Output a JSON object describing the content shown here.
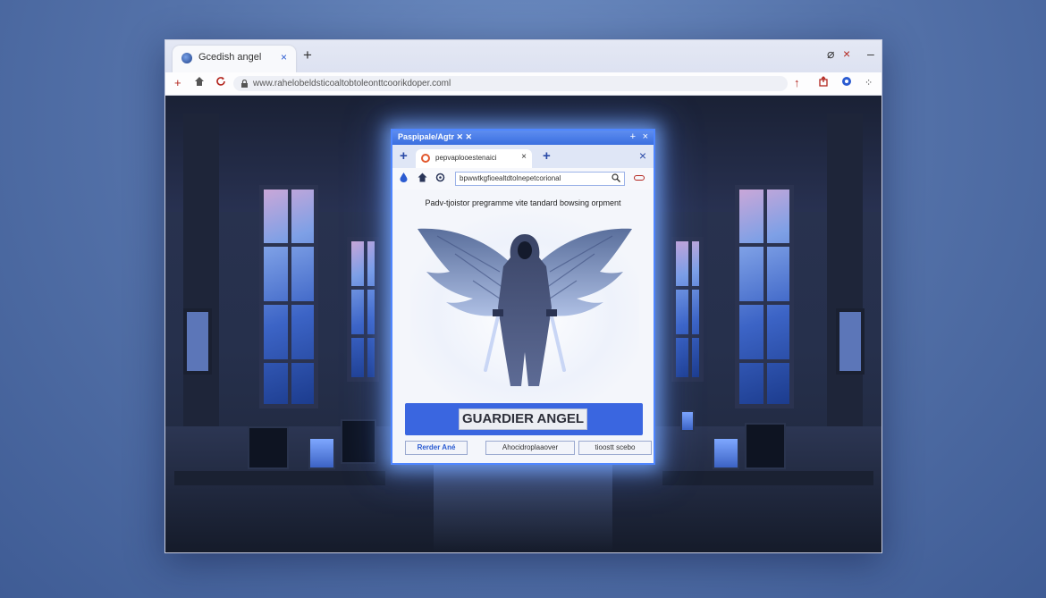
{
  "browser": {
    "tab_title": "Gcedish angel",
    "tab_close_glyph": "×",
    "new_tab_glyph": "+",
    "address_url": "www.rahelobeldsticoaltobtoleonttcoorikdoper.coml",
    "window_controls": {
      "pin": "⌀",
      "close": "×",
      "minimize": "–"
    }
  },
  "inner_window": {
    "title": "Paspipale/Agtr  ✕  ✕",
    "title_controls": {
      "plus": "+",
      "close": "×"
    },
    "tab_title": "pepvaplooestenaici",
    "tab_close_glyph": "×",
    "close_glyph": "×",
    "address": "bpwwtkgfioealtdtolnepetcorional",
    "heading": "Padv-tjoistor pregramme vite tandard bowsing orpment",
    "banner_title": "GUARDIER ANGEL",
    "buttons": [
      {
        "label": "Rerder Ané"
      },
      {
        "label": "Ahocidroplaaover"
      },
      {
        "label": "tioostt  scebo"
      }
    ]
  },
  "colors": {
    "accent": "#3a66e0",
    "glow": "#4f86ff"
  }
}
